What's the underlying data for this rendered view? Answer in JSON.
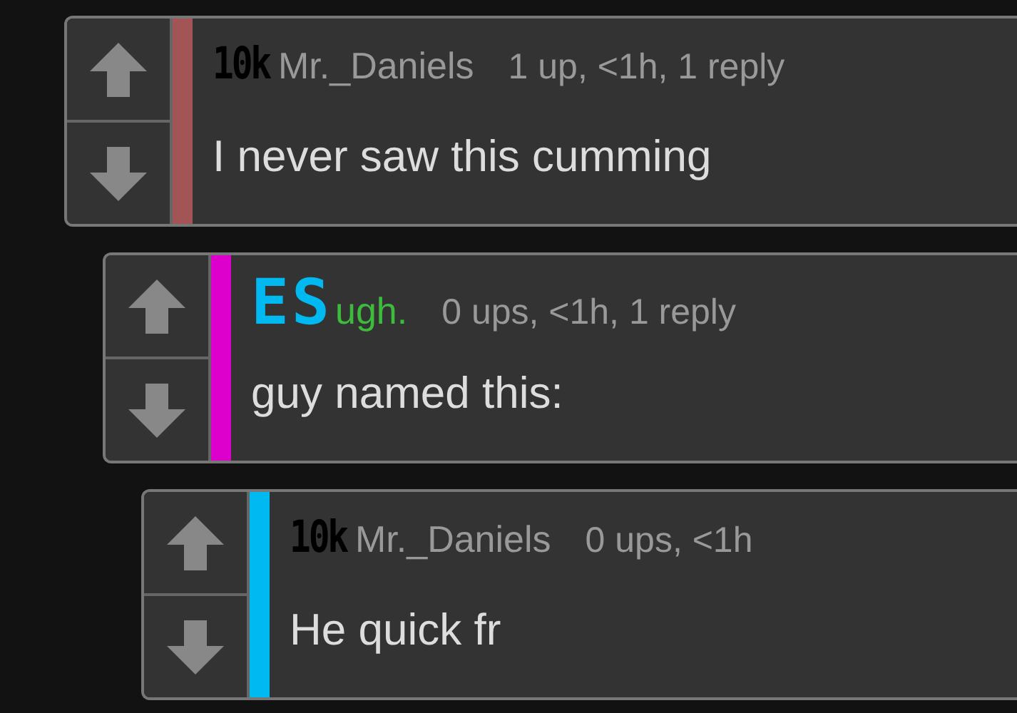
{
  "comments": [
    {
      "badge": {
        "text": "10k",
        "kind": "rank"
      },
      "user": "Mr._Daniels",
      "user_highlighted": false,
      "meta": "1 up, <1h, 1 reply",
      "body": "I never saw this cumming",
      "color": "#a35454",
      "children": [
        {
          "badge": {
            "text": "ES",
            "kind": "flair"
          },
          "user": "ugh.",
          "user_highlighted": true,
          "meta": "0 ups, <1h, 1 reply",
          "body": "guy named this:",
          "color": "#dd00cc",
          "children": [
            {
              "badge": {
                "text": "10k",
                "kind": "rank"
              },
              "user": "Mr._Daniels",
              "user_highlighted": false,
              "meta": "0 ups, <1h",
              "body": "He quick fr",
              "color": "#00b9f1"
            }
          ]
        }
      ]
    }
  ]
}
